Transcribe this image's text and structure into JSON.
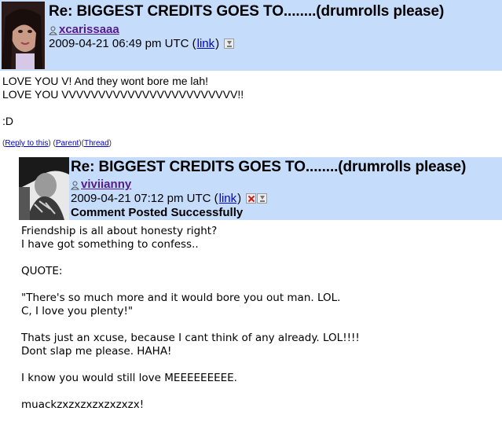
{
  "comments": [
    {
      "title": "Re: BIGGEST CREDITS GOES TO........(drumrolls please)",
      "username": "xcarissaaa",
      "timestamp": "2009-04-21 06:49 pm UTC",
      "link_label": "link",
      "body": "LOVE YOU V! And they wont bore me lah!\nLOVE YOU VVVVVVVVVVVVVVVVVVVVVVVV!!\n\n:D",
      "actions": {
        "reply": "Reply to this",
        "parent": "Parent",
        "thread": "Thread"
      }
    },
    {
      "title": "Re: BIGGEST CREDITS GOES TO........(drumrolls please)",
      "username": "viviianny",
      "timestamp": "2009-04-21 07:12 pm UTC",
      "link_label": "link",
      "status": "Comment Posted Successfully",
      "body": "Friendship is all about honesty right?\nI have got something to confess..\n\nQUOTE:\n\n\"There's so much more and it would bore you out man. LOL.\nC, I love you plenty!\"\n\nThats just an xcuse, because I cant think of any already. LOL!!!!\nDont slap me please. HAHA!\n\nI know you would still love MEEEEEEEEE.\n\nmuackzxzxzxzxzxzxzx!"
    }
  ],
  "colors": {
    "header_bg": "#c6dcfb",
    "link": "#0000cc",
    "username": "#551a8b"
  }
}
